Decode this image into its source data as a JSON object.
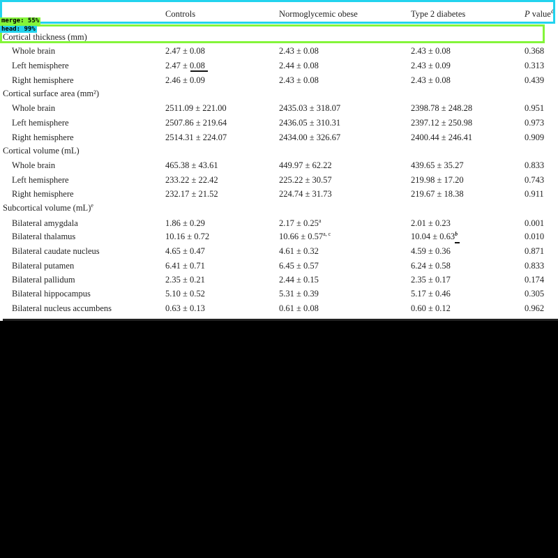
{
  "table": {
    "columns": [
      "Controls",
      "Normoglycemic obese",
      "Type 2 diabetes"
    ],
    "pvalue_header": {
      "p": "P",
      "text": " value",
      "sup": "d"
    },
    "sections": [
      {
        "label": "Cortical thickness (mm)",
        "rows": [
          {
            "label": "Whole brain",
            "controls": "2.47 ± 0.08",
            "obese": "2.43 ± 0.08",
            "diabetes": "2.43 ± 0.08",
            "p": "0.368"
          },
          {
            "label": "Left hemisphere",
            "controls": "2.47 ± 0.08",
            "obese": "2.44 ± 0.08",
            "diabetes": "2.43 ± 0.09",
            "p": "0.313"
          },
          {
            "label": "Right hemisphere",
            "controls": "2.46 ± 0.09",
            "obese": "2.43 ± 0.08",
            "diabetes": "2.43 ± 0.08",
            "p": "0.439"
          }
        ]
      },
      {
        "label": "Cortical surface area (mm²)",
        "rows": [
          {
            "label": "Whole brain",
            "controls": "2511.09 ± 221.00",
            "obese": "2435.03 ± 318.07",
            "diabetes": "2398.78 ± 248.28",
            "p": "0.951"
          },
          {
            "label": "Left hemisphere",
            "controls": "2507.86 ± 219.64",
            "obese": "2436.05 ± 310.31",
            "diabetes": "2397.12 ± 250.98",
            "p": "0.973"
          },
          {
            "label": "Right hemisphere",
            "controls": "2514.31 ± 224.07",
            "obese": "2434.00 ± 326.67",
            "diabetes": "2400.44 ± 246.41",
            "p": "0.909"
          }
        ]
      },
      {
        "label": "Cortical volume (mL)",
        "rows": [
          {
            "label": "Whole brain",
            "controls": "465.38 ± 43.61",
            "obese": "449.97 ± 62.22",
            "diabetes": "439.65 ± 35.27",
            "p": "0.833"
          },
          {
            "label": "Left hemisphere",
            "controls": "233.22 ± 22.42",
            "obese": "225.22 ± 30.57",
            "diabetes": "219.98 ± 17.20",
            "p": "0.743"
          },
          {
            "label": "Right hemisphere",
            "controls": "232.17 ± 21.52",
            "obese": "224.74 ± 31.73",
            "diabetes": "219.67 ± 18.38",
            "p": "0.911"
          }
        ]
      },
      {
        "label": "Subcortical volume (mL)",
        "label_sup": "e",
        "rows": [
          {
            "label": "Bilateral amygdala",
            "controls": "1.86 ± 0.29",
            "obese": "2.17 ± 0.25",
            "obese_sup": "a",
            "diabetes": "2.01 ± 0.23",
            "p": "0.001"
          },
          {
            "label": "Bilateral thalamus",
            "controls": "10.16 ± 0.72",
            "obese": "10.66 ± 0.57",
            "obese_sup": "a, c",
            "diabetes": "10.04 ± 0.63",
            "diabetes_sup": "b",
            "p": "0.010"
          },
          {
            "label": "Bilateral caudate nucleus",
            "controls": "4.65 ± 0.47",
            "obese": "4.61 ± 0.32",
            "diabetes": "4.59 ± 0.36",
            "p": "0.871"
          },
          {
            "label": "Bilateral putamen",
            "controls": "6.41 ± 0.71",
            "obese": "6.45 ± 0.57",
            "diabetes": "6.24 ± 0.58",
            "p": "0.833"
          },
          {
            "label": "Bilateral pallidum",
            "controls": "2.35 ± 0.21",
            "obese": "2.44 ± 0.15",
            "diabetes": "2.35 ± 0.17",
            "p": "0.174"
          },
          {
            "label": "Bilateral hippocampus",
            "controls": "5.10 ± 0.52",
            "obese": "5.31 ± 0.39",
            "diabetes": "5.17 ± 0.46",
            "p": "0.305"
          },
          {
            "label": "Bilateral nucleus accumbens",
            "controls": "0.63 ± 0.13",
            "obese": "0.61 ± 0.08",
            "diabetes": "0.60 ± 0.12",
            "p": "0.962"
          }
        ]
      }
    ]
  },
  "overlay": {
    "merge_label": "merge: 55%",
    "head_label": "head: 99%",
    "head_color": "#22d3ee",
    "merge_color": "#84f53a"
  }
}
